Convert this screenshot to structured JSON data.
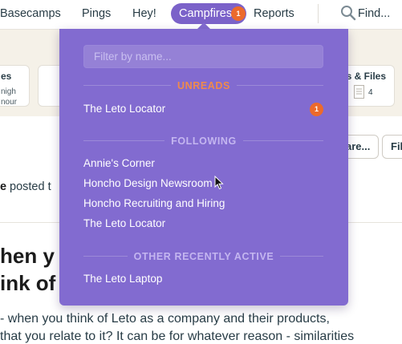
{
  "nav": {
    "items": [
      "Basecamps",
      "Pings",
      "Hey!",
      "Campfires",
      "Reports"
    ],
    "active": "Campfires",
    "campfires_badge": "1",
    "search_label": "Find..."
  },
  "background": {
    "card1_title": "es",
    "card1_lines": [
      "nigh",
      "nour"
    ],
    "card2_title": "cs & Files",
    "card2_count": "4",
    "share_button": "are...",
    "file_button": "Fil",
    "posted_prefix": "e",
    "posted_text": "posted t",
    "title_line1": "hen y",
    "title_line2": "ink of",
    "body_line1": "- when you think of Leto as a company and their products,",
    "body_line2": "that you relate to it? It can be for whatever reason - similarities"
  },
  "dropdown": {
    "filter_placeholder": "Filter by name...",
    "unreads": {
      "label": "UNREADS",
      "items": [
        {
          "name": "The Leto Locator",
          "badge": "1"
        }
      ]
    },
    "following": {
      "label": "FOLLOWING",
      "items": [
        "Annie's Corner",
        "Honcho Design Newsroom",
        "Honcho Recruiting and Hiring",
        "The Leto Locator"
      ]
    },
    "recent": {
      "label": "OTHER RECENTLY ACTIVE",
      "items": [
        "The Leto Laptop"
      ]
    }
  },
  "colors": {
    "dropdown_bg": "#826bd0",
    "pill": "#7b62c9",
    "badge": "#ec6a2c",
    "unreads_label": "#f08a4b",
    "section_label": "#c4b6f0"
  },
  "icons": [
    "search-icon",
    "document-icon",
    "mouse-pointer-icon"
  ]
}
